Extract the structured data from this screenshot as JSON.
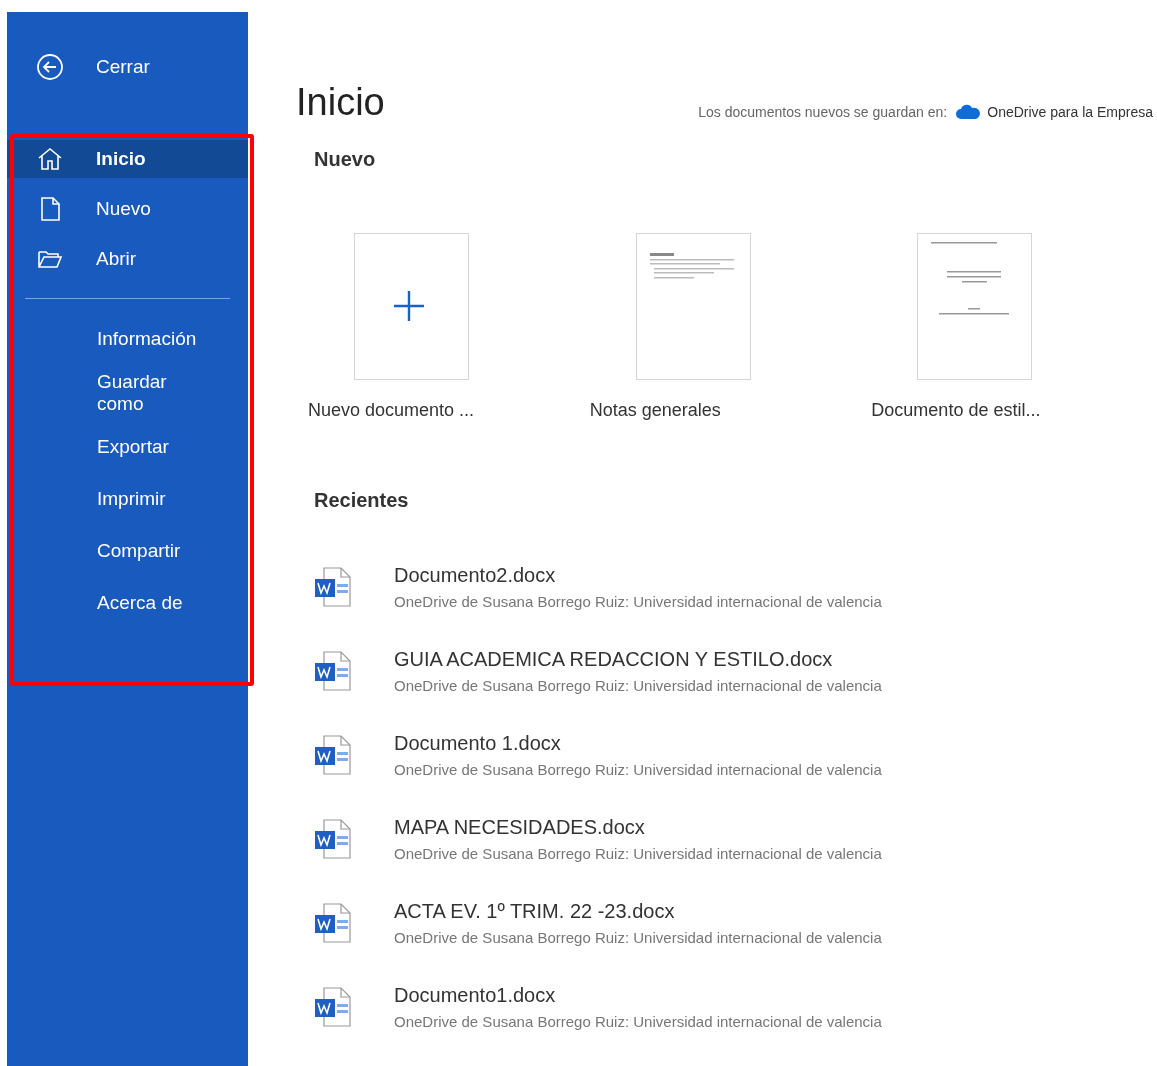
{
  "sidebar": {
    "back": {
      "label": "Cerrar"
    },
    "items": [
      {
        "label": "Inicio",
        "kind": "home",
        "selected": true
      },
      {
        "label": "Nuevo",
        "kind": "page",
        "selected": false
      },
      {
        "label": "Abrir",
        "kind": "folder",
        "selected": false
      }
    ],
    "more_items": [
      {
        "label": "Información",
        "selected": false
      },
      {
        "label": "Guardar como",
        "selected": false
      },
      {
        "label": "Exportar",
        "selected": false
      },
      {
        "label": "Imprimir",
        "selected": false
      },
      {
        "label": "Compartir",
        "selected": false
      },
      {
        "label": "Acerca de",
        "selected": false
      }
    ],
    "highlighted": true
  },
  "main": {
    "title": "Inicio",
    "save_location": {
      "label": "Los documentos nuevos se guardan en:",
      "service": "OneDrive para la Empresa"
    },
    "new_section": {
      "heading": "Nuevo",
      "templates": [
        {
          "label": "Nuevo documento ...",
          "kind": "blank"
        },
        {
          "label": "Notas generales",
          "kind": "notes"
        },
        {
          "label": "Documento de estil...",
          "kind": "style"
        }
      ]
    },
    "recent_section": {
      "heading": "Recientes",
      "files": [
        {
          "name": "Documento2.docx",
          "location": "OneDrive de Susana Borrego Ruiz: Universidad internacional de valencia"
        },
        {
          "name": "GUIA ACADEMICA REDACCION Y ESTILO.docx",
          "location": "OneDrive de Susana Borrego Ruiz: Universidad internacional de valencia"
        },
        {
          "name": "Documento 1.docx",
          "location": "OneDrive de Susana Borrego Ruiz: Universidad internacional de valencia"
        },
        {
          "name": "MAPA NECESIDADES.docx",
          "location": "OneDrive de Susana Borrego Ruiz: Universidad internacional de valencia"
        },
        {
          "name": "ACTA EV. 1º TRIM. 22 -23.docx",
          "location": "OneDrive de Susana Borrego Ruiz: Universidad internacional de valencia"
        },
        {
          "name": "Documento1.docx",
          "location": "OneDrive de Susana Borrego Ruiz: Universidad internacional de valencia"
        }
      ]
    }
  }
}
